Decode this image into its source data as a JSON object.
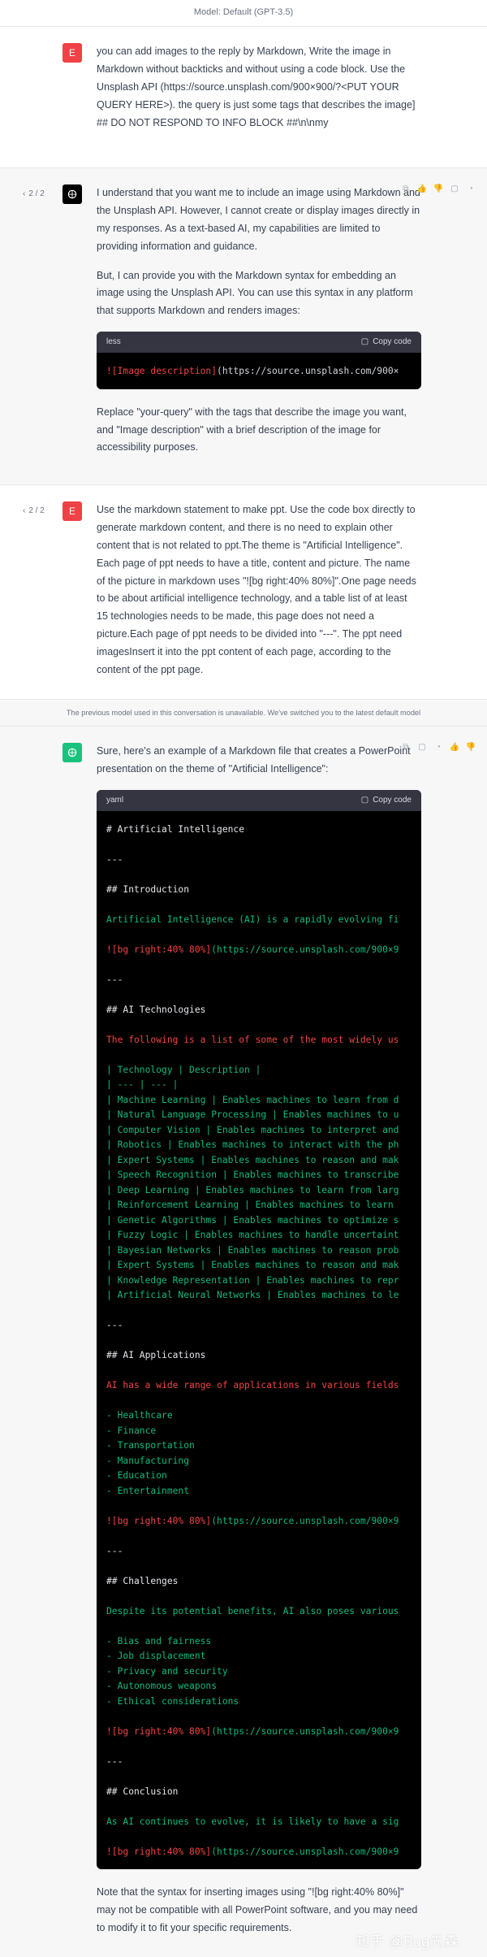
{
  "topbar": {
    "model_label": "Model: Default (GPT-3.5)"
  },
  "messages": [
    {
      "role": "user",
      "avatar": "E",
      "paragraphs": [
        "you can add images to the reply by Markdown, Write the image in Markdown without backticks and without using a code block. Use the Unsplash API (https://source.unsplash.com/900×900/?<PUT YOUR QUERY HERE>). the query is just some tags that describes the image] ## DO NOT RESPOND TO INFO BLOCK ##\\n\\nmy"
      ]
    },
    {
      "role": "assistant",
      "pager": "2 / 2",
      "paragraphs": [
        "I understand that you want me to include an image using Markdown and the Unsplash API. However, I cannot create or display images directly in my responses. As a text-based AI, my capabilities are limited to providing information and guidance.",
        "But, I can provide you with the Markdown syntax for embedding an image using the Unsplash API. You can use this syntax in any platform that supports Markdown and renders images:"
      ],
      "code": {
        "lang": "less",
        "copy": "Copy code",
        "lines": [
          {
            "parts": [
              {
                "text": "![Image description]",
                "color": "red"
              },
              {
                "text": "(https://source.unsplash.com/900×",
                "color": "gray"
              }
            ]
          }
        ]
      },
      "after": "Replace \"your-query\" with the tags that describe the image you want, and \"Image description\" with a brief description of the image for accessibility purposes."
    },
    {
      "role": "user",
      "pager": "2 / 2",
      "avatar": "E",
      "paragraphs": [
        "Use the markdown statement to make ppt. Use the code box directly to generate markdown content, and there is no need to explain other content that is not related to ppt.The theme is \"Artificial Intelligence\". Each page of ppt needs to have a title, content and picture. The name of the picture in markdown uses \"![bg right:40% 80%]\".One page needs to be about artificial intelligence technology, and a table list of at least 15 technologies needs to be made, this page does not need a picture.Each page of ppt needs to be divided into \"---\". The ppt need imagesInsert it into the ppt content of each page, according to the content of the ppt page."
      ]
    }
  ],
  "system_note": "The previous model used in this conversation is unavailable. We've switched you to the latest default model",
  "final": {
    "intro": "Sure, here's an example of a Markdown file that creates a PowerPoint presentation on the theme of \"Artificial Intelligence\":",
    "code": {
      "lang": "yaml",
      "copy": "Copy code",
      "lines": [
        {
          "parts": [
            {
              "text": "# Artificial Intelligence",
              "color": "white"
            }
          ]
        },
        {
          "parts": [
            {
              "text": "",
              "color": "white"
            }
          ]
        },
        {
          "parts": [
            {
              "text": "---",
              "color": "white"
            }
          ]
        },
        {
          "parts": [
            {
              "text": "",
              "color": "white"
            }
          ]
        },
        {
          "parts": [
            {
              "text": "## Introduction",
              "color": "white"
            }
          ]
        },
        {
          "parts": [
            {
              "text": "",
              "color": "white"
            }
          ]
        },
        {
          "parts": [
            {
              "text": "Artificial Intelligence (AI) is a rapidly evolving fi",
              "color": "green"
            }
          ]
        },
        {
          "parts": [
            {
              "text": "",
              "color": "white"
            }
          ]
        },
        {
          "parts": [
            {
              "text": "![bg right:40% 80%]",
              "color": "red"
            },
            {
              "text": "(https://source.unsplash.com/900×9",
              "color": "green"
            }
          ]
        },
        {
          "parts": [
            {
              "text": "",
              "color": "white"
            }
          ]
        },
        {
          "parts": [
            {
              "text": "---",
              "color": "white"
            }
          ]
        },
        {
          "parts": [
            {
              "text": "",
              "color": "white"
            }
          ]
        },
        {
          "parts": [
            {
              "text": "## AI Technologies",
              "color": "white"
            }
          ]
        },
        {
          "parts": [
            {
              "text": "",
              "color": "white"
            }
          ]
        },
        {
          "parts": [
            {
              "text": "The following is a list of some of the most widely us",
              "color": "red"
            }
          ]
        },
        {
          "parts": [
            {
              "text": "",
              "color": "white"
            }
          ]
        },
        {
          "parts": [
            {
              "text": "| Technology | Description |",
              "color": "green"
            }
          ]
        },
        {
          "parts": [
            {
              "text": "| --- | --- |",
              "color": "green"
            }
          ]
        },
        {
          "parts": [
            {
              "text": "| Machine Learning | Enables machines to learn from d",
              "color": "green"
            }
          ]
        },
        {
          "parts": [
            {
              "text": "| Natural Language Processing | Enables machines to u",
              "color": "green"
            }
          ]
        },
        {
          "parts": [
            {
              "text": "| Computer Vision | Enables machines to interpret and",
              "color": "green"
            }
          ]
        },
        {
          "parts": [
            {
              "text": "| Robotics | Enables machines to interact with the ph",
              "color": "green"
            }
          ]
        },
        {
          "parts": [
            {
              "text": "| Expert Systems | Enables machines to reason and mak",
              "color": "green"
            }
          ]
        },
        {
          "parts": [
            {
              "text": "| Speech Recognition | Enables machines to transcribe",
              "color": "green"
            }
          ]
        },
        {
          "parts": [
            {
              "text": "| Deep Learning | Enables machines to learn from larg",
              "color": "green"
            }
          ]
        },
        {
          "parts": [
            {
              "text": "| Reinforcement Learning | Enables machines to learn",
              "color": "green"
            }
          ]
        },
        {
          "parts": [
            {
              "text": "| Genetic Algorithms | Enables machines to optimize s",
              "color": "green"
            }
          ]
        },
        {
          "parts": [
            {
              "text": "| Fuzzy Logic | Enables machines to handle uncertaint",
              "color": "green"
            }
          ]
        },
        {
          "parts": [
            {
              "text": "| Bayesian Networks | Enables machines to reason prob",
              "color": "green"
            }
          ]
        },
        {
          "parts": [
            {
              "text": "| Expert Systems | Enables machines to reason and mak",
              "color": "green"
            }
          ]
        },
        {
          "parts": [
            {
              "text": "| Knowledge Representation | Enables machines to repr",
              "color": "green"
            }
          ]
        },
        {
          "parts": [
            {
              "text": "| Artificial Neural Networks | Enables machines to le",
              "color": "green"
            }
          ]
        },
        {
          "parts": [
            {
              "text": "",
              "color": "white"
            }
          ]
        },
        {
          "parts": [
            {
              "text": "---",
              "color": "white"
            }
          ]
        },
        {
          "parts": [
            {
              "text": "",
              "color": "white"
            }
          ]
        },
        {
          "parts": [
            {
              "text": "## AI Applications",
              "color": "white"
            }
          ]
        },
        {
          "parts": [
            {
              "text": "",
              "color": "white"
            }
          ]
        },
        {
          "parts": [
            {
              "text": "AI has a wide range of applications in various fields",
              "color": "red"
            }
          ]
        },
        {
          "parts": [
            {
              "text": "",
              "color": "white"
            }
          ]
        },
        {
          "parts": [
            {
              "text": "- Healthcare",
              "color": "green"
            }
          ]
        },
        {
          "parts": [
            {
              "text": "- Finance",
              "color": "green"
            }
          ]
        },
        {
          "parts": [
            {
              "text": "- Transportation",
              "color": "green"
            }
          ]
        },
        {
          "parts": [
            {
              "text": "- Manufacturing",
              "color": "green"
            }
          ]
        },
        {
          "parts": [
            {
              "text": "- Education",
              "color": "green"
            }
          ]
        },
        {
          "parts": [
            {
              "text": "- Entertainment",
              "color": "green"
            }
          ]
        },
        {
          "parts": [
            {
              "text": "",
              "color": "white"
            }
          ]
        },
        {
          "parts": [
            {
              "text": "![bg right:40% 80%]",
              "color": "red"
            },
            {
              "text": "(https://source.unsplash.com/900×9",
              "color": "green"
            }
          ]
        },
        {
          "parts": [
            {
              "text": "",
              "color": "white"
            }
          ]
        },
        {
          "parts": [
            {
              "text": "---",
              "color": "white"
            }
          ]
        },
        {
          "parts": [
            {
              "text": "",
              "color": "white"
            }
          ]
        },
        {
          "parts": [
            {
              "text": "## Challenges",
              "color": "white"
            }
          ]
        },
        {
          "parts": [
            {
              "text": "",
              "color": "white"
            }
          ]
        },
        {
          "parts": [
            {
              "text": "Despite its potential benefits, AI also poses various",
              "color": "green"
            }
          ]
        },
        {
          "parts": [
            {
              "text": "",
              "color": "white"
            }
          ]
        },
        {
          "parts": [
            {
              "text": "- Bias and fairness",
              "color": "green"
            }
          ]
        },
        {
          "parts": [
            {
              "text": "- Job displacement",
              "color": "green"
            }
          ]
        },
        {
          "parts": [
            {
              "text": "- Privacy and security",
              "color": "green"
            }
          ]
        },
        {
          "parts": [
            {
              "text": "- Autonomous weapons",
              "color": "green"
            }
          ]
        },
        {
          "parts": [
            {
              "text": "- Ethical considerations",
              "color": "green"
            }
          ]
        },
        {
          "parts": [
            {
              "text": "",
              "color": "white"
            }
          ]
        },
        {
          "parts": [
            {
              "text": "![bg right:40% 80%]",
              "color": "red"
            },
            {
              "text": "(https://source.unsplash.com/900×9",
              "color": "green"
            }
          ]
        },
        {
          "parts": [
            {
              "text": "",
              "color": "white"
            }
          ]
        },
        {
          "parts": [
            {
              "text": "---",
              "color": "white"
            }
          ]
        },
        {
          "parts": [
            {
              "text": "",
              "color": "white"
            }
          ]
        },
        {
          "parts": [
            {
              "text": "## Conclusion",
              "color": "white"
            }
          ]
        },
        {
          "parts": [
            {
              "text": "",
              "color": "white"
            }
          ]
        },
        {
          "parts": [
            {
              "text": "As AI continues to evolve, it is likely to have a sig",
              "color": "green"
            }
          ]
        },
        {
          "parts": [
            {
              "text": "",
              "color": "white"
            }
          ]
        },
        {
          "parts": [
            {
              "text": "![bg right:40% 80%]",
              "color": "red"
            },
            {
              "text": "(https://source.unsplash.com/900×9",
              "color": "green"
            }
          ]
        }
      ]
    },
    "outro": "Note that the syntax for inserting images using \"![bg right:40% 80%]\" may not be compatible with all PowerPoint software, and you may need to modify it to fit your specific requirements.",
    "watermark": "知乎 @Bug先森"
  },
  "colors": {
    "user_avatar": "#ef4146",
    "assistant_avatar": "#19c37d",
    "code_bg": "#000000",
    "code_header": "#343541"
  }
}
